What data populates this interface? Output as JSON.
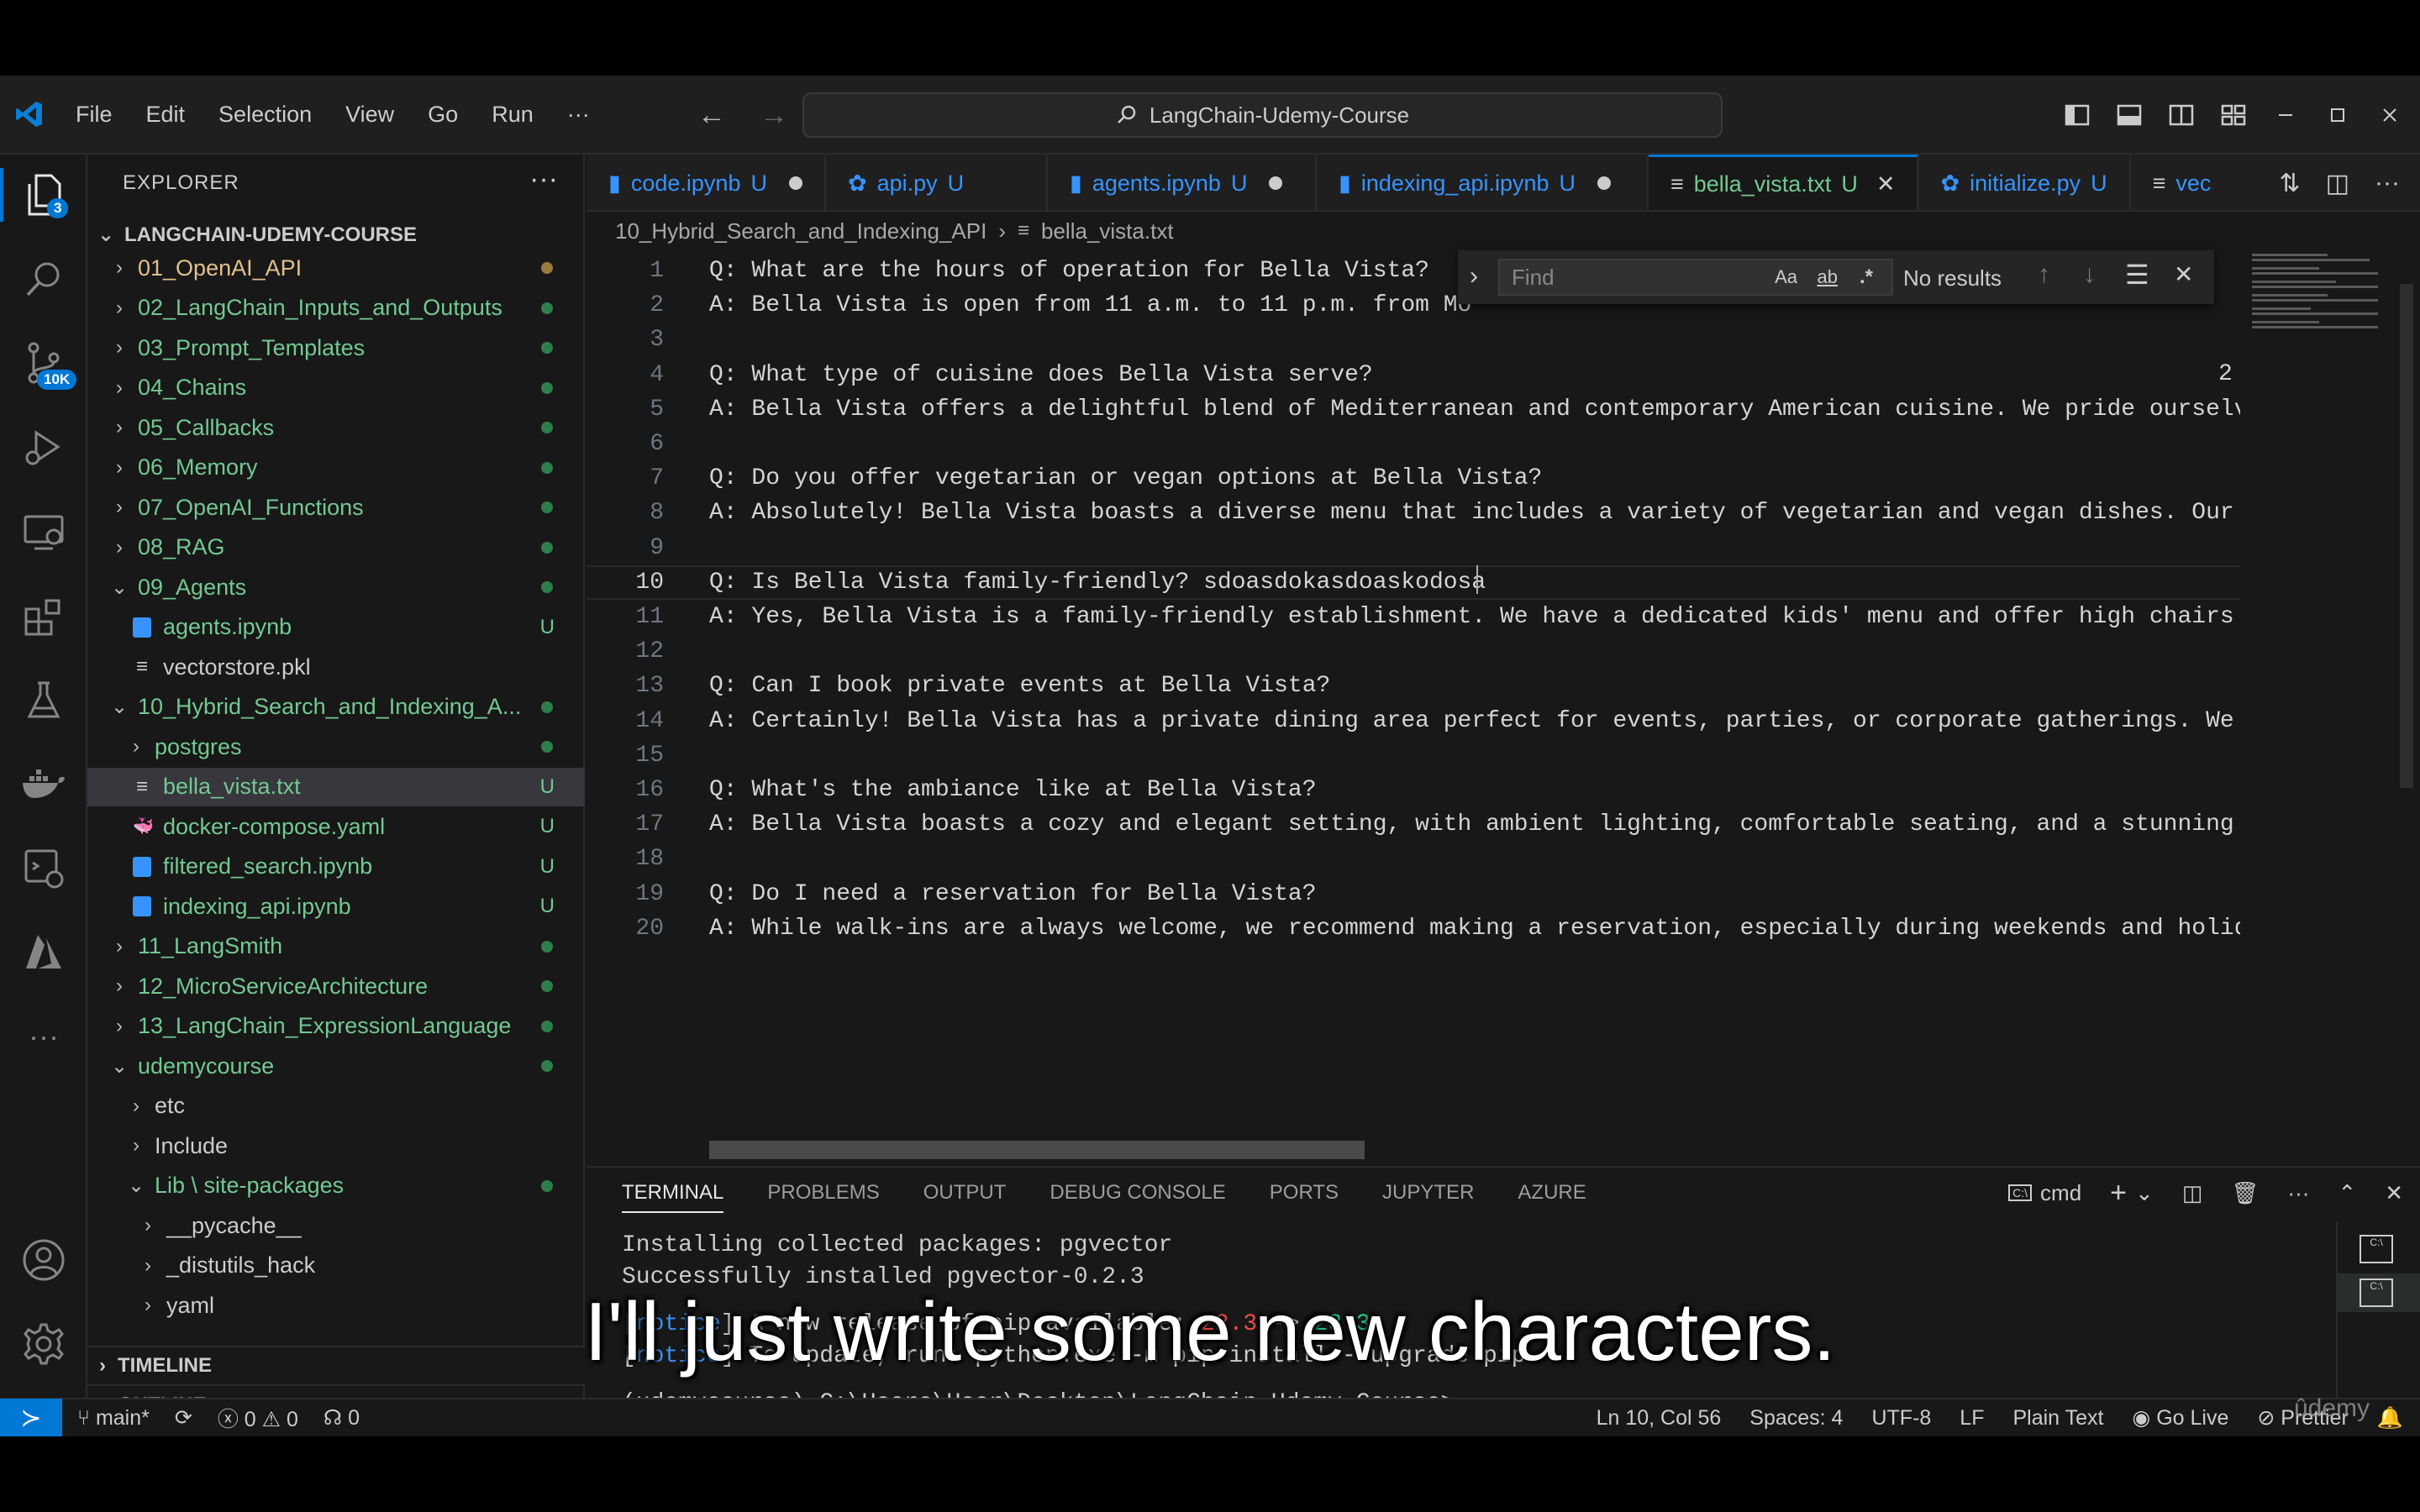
{
  "titlebar": {
    "menu": [
      "File",
      "Edit",
      "Selection",
      "View",
      "Go",
      "Run",
      "···"
    ],
    "search": "LangChain-Udemy-Course"
  },
  "activity": {
    "explorer_badge": "3",
    "scm_badge": "10K"
  },
  "explorer": {
    "header": "EXPLORER",
    "root": "LANGCHAIN-UDEMY-COURSE",
    "rows": [
      {
        "label": "01_OpenAI_API",
        "chev": "›",
        "indent": 1,
        "status": "",
        "color": "#e2c08d",
        "dot": "#9a7b3e"
      },
      {
        "label": "02_LangChain_Inputs_and_Outputs",
        "chev": "›",
        "indent": 1,
        "status": "",
        "color": "#73c991",
        "dot": "#2f7d4b"
      },
      {
        "label": "03_Prompt_Templates",
        "chev": "›",
        "indent": 1,
        "status": "",
        "color": "#73c991",
        "dot": "#2f7d4b"
      },
      {
        "label": "04_Chains",
        "chev": "›",
        "indent": 1,
        "status": "",
        "color": "#73c991",
        "dot": "#2f7d4b"
      },
      {
        "label": "05_Callbacks",
        "chev": "›",
        "indent": 1,
        "status": "",
        "color": "#73c991",
        "dot": "#2f7d4b"
      },
      {
        "label": "06_Memory",
        "chev": "›",
        "indent": 1,
        "status": "",
        "color": "#73c991",
        "dot": "#2f7d4b"
      },
      {
        "label": "07_OpenAI_Functions",
        "chev": "›",
        "indent": 1,
        "status": "",
        "color": "#73c991",
        "dot": "#2f7d4b"
      },
      {
        "label": "08_RAG",
        "chev": "›",
        "indent": 1,
        "status": "",
        "color": "#73c991",
        "dot": "#2f7d4b"
      },
      {
        "label": "09_Agents",
        "chev": "⌄",
        "indent": 1,
        "status": "",
        "color": "#73c991",
        "dot": "#2f7d4b"
      },
      {
        "label": "agents.ipynb",
        "chev": "",
        "indent": 2,
        "status": "U",
        "color": "#73c991",
        "icon": "notebook"
      },
      {
        "label": "vectorstore.pkl",
        "chev": "",
        "indent": 2,
        "status": "",
        "color": "#cccccc",
        "icon": "lines"
      },
      {
        "label": "10_Hybrid_Search_and_Indexing_A...",
        "chev": "⌄",
        "indent": 1,
        "status": "",
        "color": "#73c991",
        "dot": "#2f7d4b"
      },
      {
        "label": "postgres",
        "chev": "›",
        "indent": 2,
        "status": "",
        "color": "#73c991",
        "dot": "#2f7d4b"
      },
      {
        "label": "bella_vista.txt",
        "chev": "",
        "indent": 2,
        "status": "U",
        "color": "#73c991",
        "icon": "lines",
        "selected": true
      },
      {
        "label": "docker-compose.yaml",
        "chev": "",
        "indent": 2,
        "status": "U",
        "color": "#73c991",
        "icon": "whale"
      },
      {
        "label": "filtered_search.ipynb",
        "chev": "",
        "indent": 2,
        "status": "U",
        "color": "#73c991",
        "icon": "notebook"
      },
      {
        "label": "indexing_api.ipynb",
        "chev": "",
        "indent": 2,
        "status": "U",
        "color": "#73c991",
        "icon": "notebook"
      },
      {
        "label": "11_LangSmith",
        "chev": "›",
        "indent": 1,
        "status": "",
        "color": "#73c991",
        "dot": "#2f7d4b"
      },
      {
        "label": "12_MicroServiceArchitecture",
        "chev": "›",
        "indent": 1,
        "status": "",
        "color": "#73c991",
        "dot": "#2f7d4b"
      },
      {
        "label": "13_LangChain_ExpressionLanguage",
        "chev": "›",
        "indent": 1,
        "status": "",
        "color": "#73c991",
        "dot": "#2f7d4b"
      },
      {
        "label": "udemycourse",
        "chev": "⌄",
        "indent": 1,
        "status": "",
        "color": "#73c991",
        "dot": "#2f7d4b"
      },
      {
        "label": "etc",
        "chev": "›",
        "indent": 2,
        "status": "",
        "color": "#cccccc"
      },
      {
        "label": "Include",
        "chev": "›",
        "indent": 2,
        "status": "",
        "color": "#cccccc"
      },
      {
        "label": "Lib \\ site-packages",
        "chev": "⌄",
        "indent": 2,
        "status": "",
        "color": "#73c991",
        "dot": "#2f7d4b"
      },
      {
        "label": "__pycache__",
        "chev": "›",
        "indent": 3,
        "status": "",
        "color": "#cccccc"
      },
      {
        "label": "_distutils_hack",
        "chev": "›",
        "indent": 3,
        "status": "",
        "color": "#cccccc"
      },
      {
        "label": "yaml",
        "chev": "›",
        "indent": 3,
        "status": "",
        "color": "#cccccc"
      }
    ],
    "sections": [
      "OUTLINE",
      "TIMELINE"
    ]
  },
  "tabs": [
    {
      "label": "code.ipynb",
      "status": "U",
      "modified": true,
      "icon": "notebook",
      "active": false
    },
    {
      "label": "api.py",
      "status": "U",
      "modified": false,
      "icon": "python",
      "active": false
    },
    {
      "label": "agents.ipynb",
      "status": "U",
      "modified": true,
      "icon": "notebook",
      "active": false
    },
    {
      "label": "indexing_api.ipynb",
      "status": "U",
      "modified": true,
      "icon": "notebook",
      "active": false
    },
    {
      "label": "bella_vista.txt",
      "status": "U",
      "modified": false,
      "icon": "lines",
      "active": true,
      "close": "✕"
    },
    {
      "label": "initialize.py",
      "status": "U",
      "modified": false,
      "icon": "python",
      "active": false
    },
    {
      "label": "vec",
      "status": "",
      "modified": false,
      "icon": "lines",
      "active": false
    }
  ],
  "breadcrumb": {
    "folder": "10_Hybrid_Search_and_Indexing_API",
    "sep": "›",
    "file": "bella_vista.txt"
  },
  "find": {
    "placeholder": "Find",
    "aa": "Aa",
    "ab": "ab",
    "regex": ".*",
    "result": "No results"
  },
  "code_lines": [
    "Q: What are the hours of operation for Bella Vista?",
    "A: Bella Vista is open from 11 a.m. to 11 p.m. from Mo",
    "",
    "Q: What type of cuisine does Bella Vista serve?",
    "A: Bella Vista offers a delightful blend of Mediterranean and contemporary American cuisine. We pride ourselve",
    "",
    "Q: Do you offer vegetarian or vegan options at Bella Vista?",
    "A: Absolutely! Bella Vista boasts a diverse menu that includes a variety of vegetarian and vegan dishes. Our c",
    "",
    "Q: Is Bella Vista family-friendly? sdoasdokasdoaskodosa",
    "A: Yes, Bella Vista is a family-friendly establishment. We have a dedicated kids' menu and offer high chairs a",
    "",
    "Q: Can I book private events at Bella Vista?",
    "A: Certainly! Bella Vista has a private dining area perfect for events, parties, or corporate gatherings. We a",
    "",
    "Q: What's the ambiance like at Bella Vista?",
    "A: Bella Vista boasts a cozy and elegant setting, with ambient lighting, comfortable seating, and a stunning v",
    "",
    "Q: Do I need a reservation for Bella Vista?",
    "A: While walk-ins are always welcome, we recommend making a reservation, especially during weekends and holida"
  ],
  "current_line": 10,
  "line2_tail": "2",
  "panel": {
    "tabs": [
      "TERMINAL",
      "PROBLEMS",
      "OUTPUT",
      "DEBUG CONSOLE",
      "PORTS",
      "JUPYTER",
      "AZURE"
    ],
    "shell": "cmd",
    "lines": [
      "Installing collected packages: pgvector",
      "Successfully installed pgvector-0.2.3",
      "",
      "[notice] A new release of pip available: 22.3 -> 23.3",
      "[notice] To update, run: python.exe -m pip install --upgrade pip",
      "",
      "(udemycourse) C:\\Users\\User\\Desktop\\LangChain-Udemy-Course>"
    ],
    "notice_old": "22.3",
    "notice_new": "23.3"
  },
  "statusbar": {
    "branch": "main*",
    "errors": "0",
    "warnings": "0",
    "ports": "0",
    "position": "Ln 10, Col 56",
    "spaces": "Spaces: 4",
    "encoding": "UTF-8",
    "eol": "LF",
    "language": "Plain Text",
    "golive": "Go Live",
    "prettier": "Prettier"
  },
  "caption": "I'll just write some new characters.",
  "watermark": "ûdemy"
}
